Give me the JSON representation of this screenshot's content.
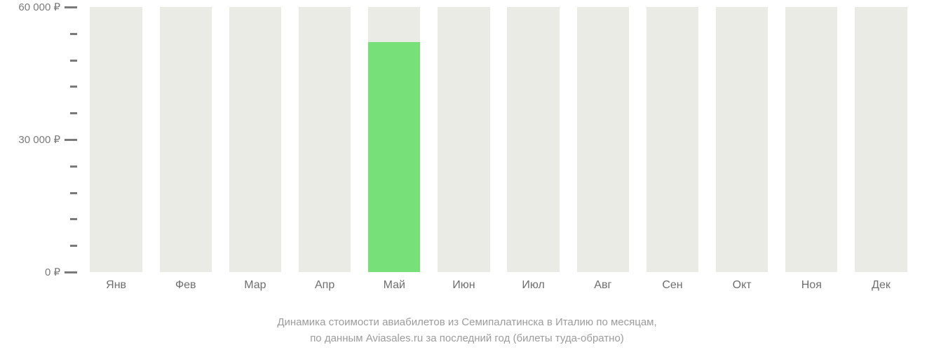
{
  "chart_data": {
    "type": "bar",
    "categories": [
      "Янв",
      "Фев",
      "Мар",
      "Апр",
      "Май",
      "Июн",
      "Июл",
      "Авг",
      "Сен",
      "Окт",
      "Ноя",
      "Дек"
    ],
    "values": [
      null,
      null,
      null,
      null,
      52000,
      null,
      null,
      null,
      null,
      null,
      null,
      null
    ],
    "title": "",
    "xlabel": "",
    "ylabel": "",
    "ylim": [
      0,
      60000
    ],
    "y_ticks_major": [
      0,
      30000,
      60000
    ],
    "y_tick_labels": [
      "0 ₽",
      "30 000 ₽",
      "60 000 ₽"
    ],
    "y_ticks_minor_count": 4,
    "currency": "₽"
  },
  "caption_line1": "Динамика стоимости авиабилетов из Семипалатинска в Италию по месяцам,",
  "caption_line2": "по данным Aviasales.ru за последний год (билеты туда-обратно)"
}
